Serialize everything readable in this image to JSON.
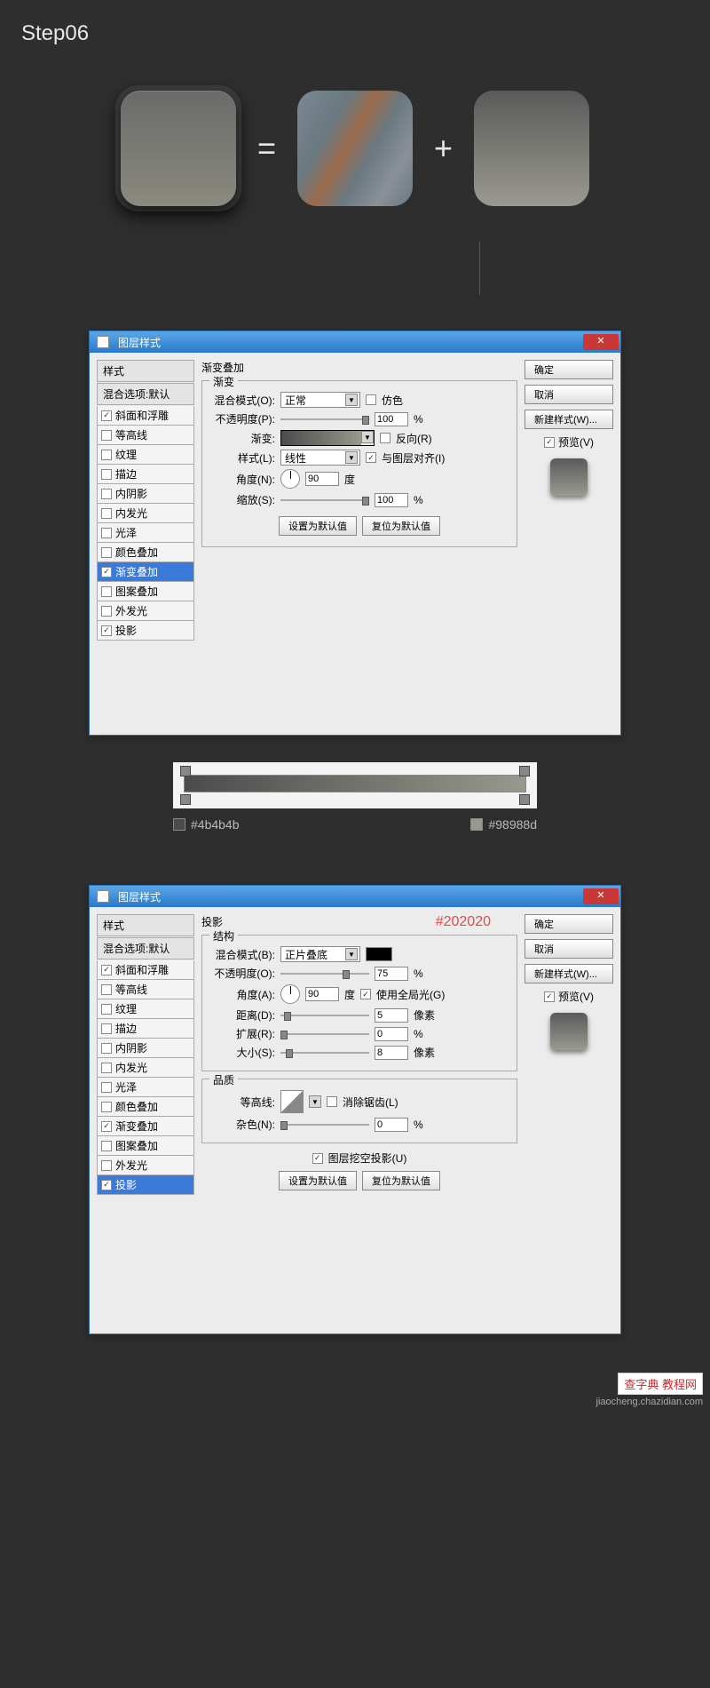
{
  "step_label": "Step06",
  "symbols": {
    "equals": "=",
    "plus": "+"
  },
  "gradient_stops": {
    "left": "#4b4b4b",
    "right": "#98988d"
  },
  "dialog1": {
    "title": "图层样式",
    "close": "✕",
    "sidebar_head": "样式",
    "blend_head": "混合选项:默认",
    "items": [
      {
        "label": "斜面和浮雕",
        "checked": true,
        "active": false
      },
      {
        "label": "等高线",
        "checked": false,
        "active": false
      },
      {
        "label": "纹理",
        "checked": false,
        "active": false
      },
      {
        "label": "描边",
        "checked": false,
        "active": false
      },
      {
        "label": "内阴影",
        "checked": false,
        "active": false
      },
      {
        "label": "内发光",
        "checked": false,
        "active": false
      },
      {
        "label": "光泽",
        "checked": false,
        "active": false
      },
      {
        "label": "颜色叠加",
        "checked": false,
        "active": false
      },
      {
        "label": "渐变叠加",
        "checked": true,
        "active": true
      },
      {
        "label": "图案叠加",
        "checked": false,
        "active": false
      },
      {
        "label": "外发光",
        "checked": false,
        "active": false
      },
      {
        "label": "投影",
        "checked": true,
        "active": false
      }
    ],
    "section_title": "渐变叠加",
    "subsection": "渐变",
    "blend_mode_label": "混合模式(O):",
    "blend_mode_value": "正常",
    "dither_label": "仿色",
    "opacity_label": "不透明度(P):",
    "opacity_value": "100",
    "pct": "%",
    "gradient_label": "渐变:",
    "reverse_label": "反向(R)",
    "style_label": "样式(L):",
    "style_value": "线性",
    "align_label": "与图层对齐(I)",
    "angle_label": "角度(N):",
    "angle_value": "90",
    "degree": "度",
    "scale_label": "缩放(S):",
    "scale_value": "100",
    "set_default": "设置为默认值",
    "reset_default": "复位为默认值",
    "ok": "确定",
    "cancel": "取消",
    "new_style": "新建样式(W)...",
    "preview_label": "预览(V)"
  },
  "dialog2": {
    "title": "图层样式",
    "close": "✕",
    "sidebar_head": "样式",
    "blend_head": "混合选项:默认",
    "annotation": "#202020",
    "items": [
      {
        "label": "斜面和浮雕",
        "checked": true,
        "active": false
      },
      {
        "label": "等高线",
        "checked": false,
        "active": false
      },
      {
        "label": "纹理",
        "checked": false,
        "active": false
      },
      {
        "label": "描边",
        "checked": false,
        "active": false
      },
      {
        "label": "内阴影",
        "checked": false,
        "active": false
      },
      {
        "label": "内发光",
        "checked": false,
        "active": false
      },
      {
        "label": "光泽",
        "checked": false,
        "active": false
      },
      {
        "label": "颜色叠加",
        "checked": false,
        "active": false
      },
      {
        "label": "渐变叠加",
        "checked": true,
        "active": false
      },
      {
        "label": "图案叠加",
        "checked": false,
        "active": false
      },
      {
        "label": "外发光",
        "checked": false,
        "active": false
      },
      {
        "label": "投影",
        "checked": true,
        "active": true
      }
    ],
    "section_title": "投影",
    "structure": "结构",
    "blend_mode_label": "混合模式(B):",
    "blend_mode_value": "正片叠底",
    "opacity_label": "不透明度(O):",
    "opacity_value": "75",
    "pct": "%",
    "angle_label": "角度(A):",
    "angle_value": "90",
    "degree": "度",
    "global_light_label": "使用全局光(G)",
    "distance_label": "距离(D):",
    "distance_value": "5",
    "px": "像素",
    "spread_label": "扩展(R):",
    "spread_value": "0",
    "size_label": "大小(S):",
    "size_value": "8",
    "quality": "品质",
    "contour_label": "等高线:",
    "antialias_label": "消除锯齿(L)",
    "noise_label": "杂色(N):",
    "noise_value": "0",
    "knockout_label": "图层挖空投影(U)",
    "set_default": "设置为默认值",
    "reset_default": "复位为默认值",
    "ok": "确定",
    "cancel": "取消",
    "new_style": "新建样式(W)...",
    "preview_label": "预览(V)"
  },
  "watermark": {
    "brand": "查字典 教程网",
    "url": "jiaocheng.chazidian.com"
  }
}
